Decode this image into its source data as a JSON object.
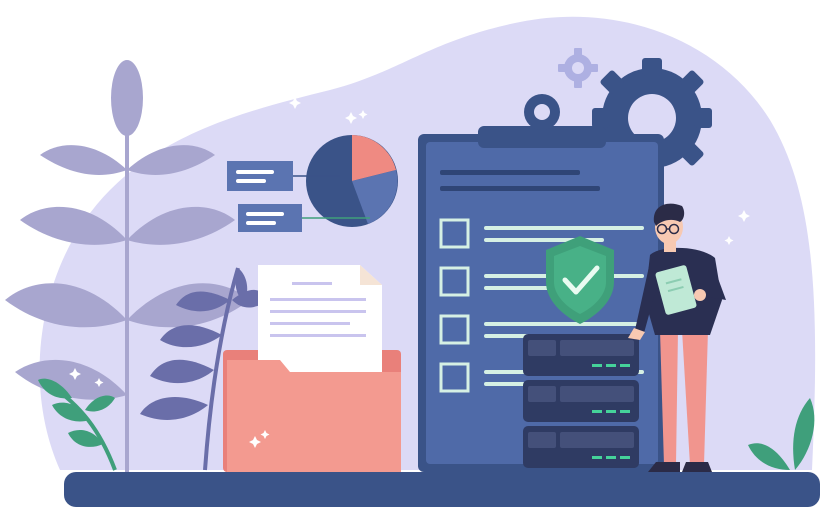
{
  "scene": {
    "subject": "data-security-checklist-illustration",
    "colors": {
      "background": "#ffffff",
      "blob": "#dcdaf6",
      "navy": "#3a5388",
      "clipboard": "#4f6aa8",
      "clipboard_dark": "#3a5388",
      "checkbox_line": "#d6f0e4",
      "shield": "#3fa07a",
      "shield_check": "#e9fbf1",
      "folder": "#f39a90",
      "folder_dark": "#e9807a",
      "paper": "#ffffff",
      "pie_a": "#3a5388",
      "pie_b": "#ef8a82",
      "pie_c": "#5b74b1",
      "leaf_light": "#a8a6cf",
      "leaf_mid": "#6a6ea9",
      "leaf_green": "#3f9f7b",
      "server": "#2f3b63",
      "server_accent": "#45d39a",
      "person_skin": "#f7c9b2",
      "person_hair": "#2b2b47",
      "person_shirt": "#2a2f52",
      "person_pants": "#f1958e",
      "tablet": "#bfe9d6",
      "sparkle": "#ffffff"
    },
    "icons": [
      "gear-icon",
      "small-gear-icon",
      "shield-check-icon",
      "pie-chart-icon",
      "document-icon",
      "folder-icon",
      "server-icon"
    ],
    "checklist": {
      "items": 4
    },
    "server_units": 3
  }
}
